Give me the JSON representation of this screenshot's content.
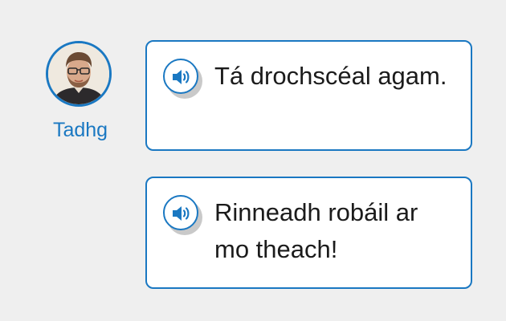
{
  "speaker": {
    "name": "Tadhg"
  },
  "messages": [
    {
      "text": "Tá drochscéal agam."
    },
    {
      "text": "Rinneadh robáil ar mo theach!"
    }
  ],
  "colors": {
    "accent": "#1a78c2",
    "background": "#efefef",
    "bubble": "#ffffff",
    "text": "#1b1b1b"
  },
  "icons": {
    "audio": "speaker-volume-icon"
  }
}
